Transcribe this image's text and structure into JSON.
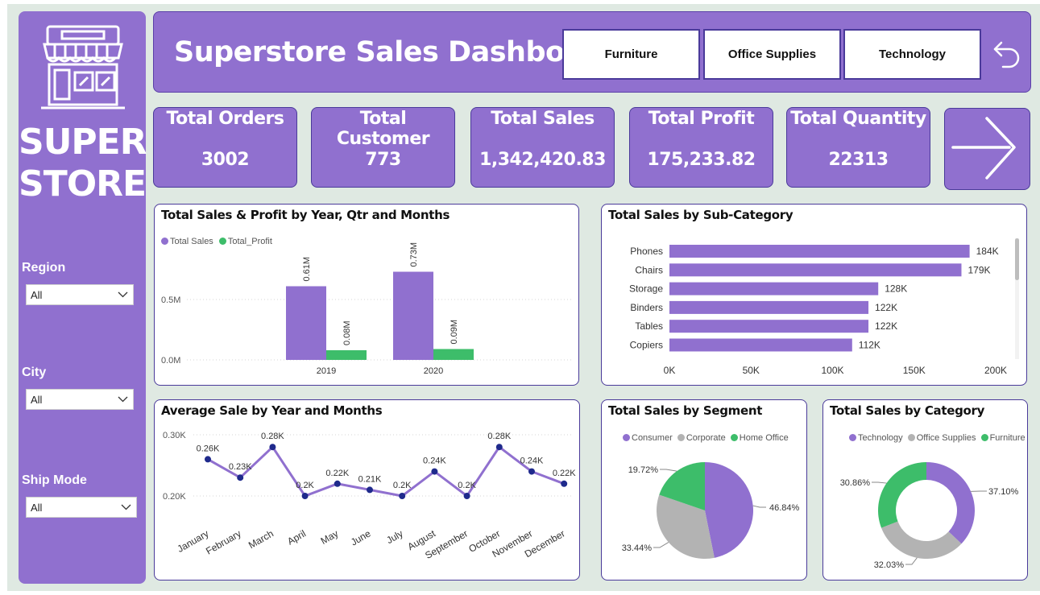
{
  "brand": {
    "line1": "SUPER",
    "line2": "STORE"
  },
  "filters": [
    {
      "label": "Region",
      "value": "All"
    },
    {
      "label": "City",
      "value": "All"
    },
    {
      "label": "Ship Mode",
      "value": "All"
    }
  ],
  "header": {
    "title": "Superstore Sales Dashboard",
    "category_buttons": [
      "Furniture",
      "Office Supplies",
      "Technology"
    ],
    "back_icon": "back-arrow-icon"
  },
  "kpis": [
    {
      "label": "Total Orders",
      "value": "3002"
    },
    {
      "label": "Total Customer",
      "value": "773"
    },
    {
      "label": "Total Sales",
      "value": "1,342,420.83"
    },
    {
      "label": "Total Profit",
      "value": "175,233.82"
    },
    {
      "label": "Total Quantity",
      "value": "22313"
    }
  ],
  "next_icon": "arrow-right-icon",
  "colors": {
    "purple": "#9070cf",
    "green": "#3dbd6a",
    "gray": "#b3b3b3",
    "dark_blue": "#1f2a8c"
  },
  "chart_data": [
    {
      "id": "sales_profit",
      "type": "bar",
      "title": "Total Sales & Profit by Year, Qtr and Months",
      "categories": [
        "2019",
        "2020"
      ],
      "series": [
        {
          "name": "Total Sales",
          "values": [
            0.61,
            0.73
          ],
          "labels": [
            "0.61M",
            "0.73M"
          ]
        },
        {
          "name": "Total_Profit",
          "values": [
            0.08,
            0.09
          ],
          "labels": [
            "0.08M",
            "0.09M"
          ]
        }
      ],
      "y_ticks": [
        "0.0M",
        "0.5M"
      ],
      "ylim": [
        0,
        0.82
      ]
    },
    {
      "id": "subcategory",
      "type": "bar",
      "orientation": "horizontal",
      "title": "Total Sales by Sub-Category",
      "categories": [
        "Phones",
        "Chairs",
        "Storage",
        "Binders",
        "Tables",
        "Copiers"
      ],
      "values": [
        184,
        179,
        128,
        122,
        122,
        112
      ],
      "labels": [
        "184K",
        "179K",
        "128K",
        "122K",
        "122K",
        "112K"
      ],
      "x_ticks": [
        "0K",
        "50K",
        "100K",
        "150K",
        "200K"
      ],
      "xlim": [
        0,
        200
      ]
    },
    {
      "id": "avg_sale",
      "type": "line",
      "title": "Average Sale by Year and Months",
      "categories": [
        "January",
        "February",
        "March",
        "April",
        "May",
        "June",
        "July",
        "August",
        "September",
        "October",
        "November",
        "December"
      ],
      "values": [
        0.26,
        0.23,
        0.28,
        0.2,
        0.22,
        0.21,
        0.2,
        0.24,
        0.2,
        0.28,
        0.24,
        0.22
      ],
      "labels": [
        "0.26K",
        "0.23K",
        "0.28K",
        "0.2K",
        "0.22K",
        "0.21K",
        "0.2K",
        "0.24K",
        "0.2K",
        "0.28K",
        "0.24K",
        "0.22K"
      ],
      "y_ticks": [
        "0.20K",
        "0.30K"
      ],
      "ylim": [
        0.2,
        0.3
      ]
    },
    {
      "id": "segment",
      "type": "pie",
      "title": "Total Sales by Segment",
      "slices": [
        {
          "name": "Consumer",
          "value": 46.84,
          "label": "46.84%"
        },
        {
          "name": "Corporate",
          "value": 33.44,
          "label": "33.44%"
        },
        {
          "name": "Home Office",
          "value": 19.72,
          "label": "19.72%"
        }
      ]
    },
    {
      "id": "category",
      "type": "pie",
      "subtype": "donut",
      "title": "Total Sales by Category",
      "slices": [
        {
          "name": "Technology",
          "value": 37.1,
          "label": "37.10%"
        },
        {
          "name": "Office Supplies",
          "value": 32.03,
          "label": "32.03%"
        },
        {
          "name": "Furniture",
          "value": 30.86,
          "label": "30.86%"
        }
      ]
    }
  ]
}
